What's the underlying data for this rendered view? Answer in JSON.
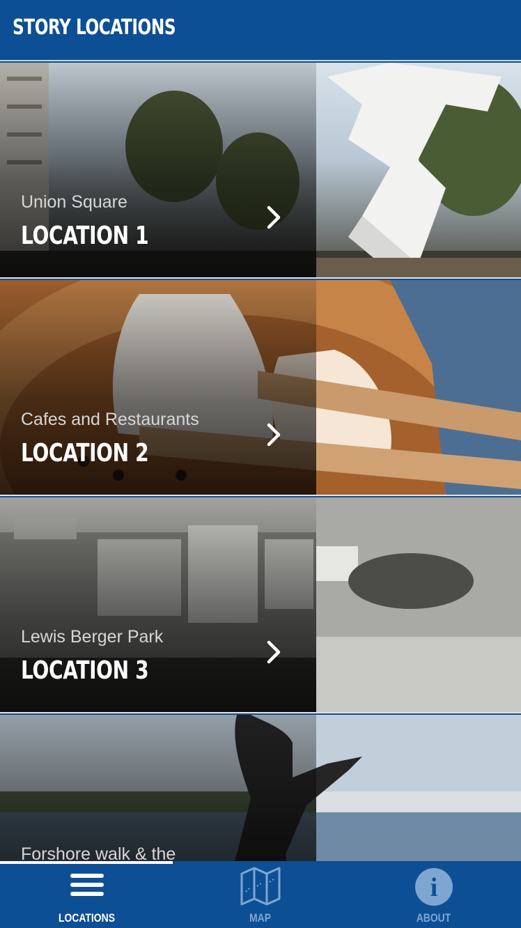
{
  "header": {
    "title": "STORY LOCATIONS"
  },
  "locations": [
    {
      "subtitle": "Union Square",
      "label": "LOCATION 1"
    },
    {
      "subtitle": "Cafes and Restaurants",
      "label": "LOCATION 2"
    },
    {
      "subtitle": "Lewis Berger Park",
      "label": "LOCATION 3"
    },
    {
      "subtitle": "Forshore walk & the",
      "label": ""
    }
  ],
  "tabbar": {
    "tabs": [
      {
        "label": "LOCATIONS",
        "icon": "menu-icon",
        "active": true
      },
      {
        "label": "MAP",
        "icon": "map-icon",
        "active": false
      },
      {
        "label": "ABOUT",
        "icon": "info-icon",
        "active": false
      }
    ]
  },
  "colors": {
    "brand": "#0d4f95",
    "inactive_tab": "#7fa6d1"
  }
}
